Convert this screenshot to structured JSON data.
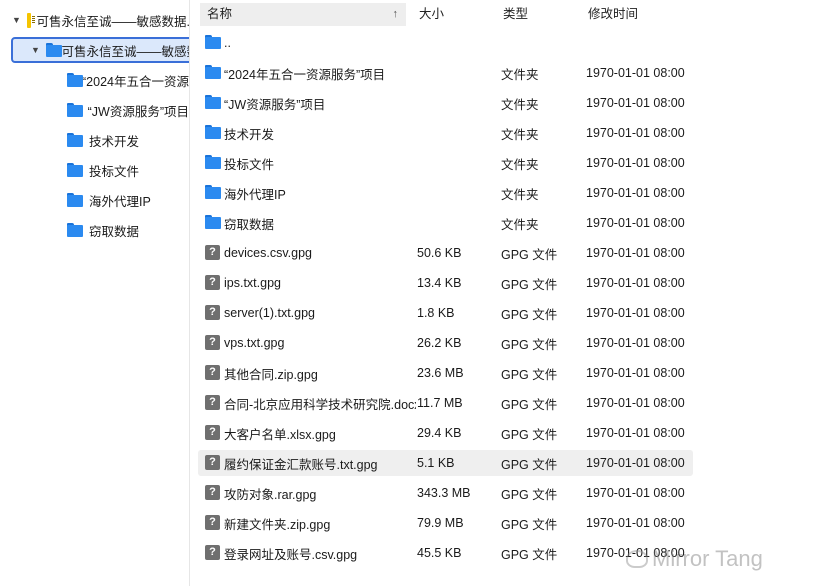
{
  "tree": {
    "root_label": "可售永信至诚——敏感数据.",
    "selected_label": "可售永信至诚——敏感数",
    "children": [
      {
        "label": "“2024年五合一资源"
      },
      {
        "label": "“JW资源服务”项目"
      },
      {
        "label": "技术开发"
      },
      {
        "label": "投标文件"
      },
      {
        "label": "海外代理IP"
      },
      {
        "label": "窃取数据"
      }
    ]
  },
  "columns": {
    "name": "名称",
    "size": "大小",
    "type": "类型",
    "modified": "修改时间",
    "sort_indicator": "↑"
  },
  "files": [
    {
      "icon": "folder-icon",
      "name": "..",
      "size": "",
      "type": "",
      "modified": ""
    },
    {
      "icon": "folder-icon",
      "name": "“2024年五合一资源服务”项目",
      "size": "",
      "type": "文件夹",
      "modified": "1970-01-01 08:00"
    },
    {
      "icon": "folder-icon",
      "name": "“JW资源服务”项目",
      "size": "",
      "type": "文件夹",
      "modified": "1970-01-01 08:00"
    },
    {
      "icon": "folder-icon",
      "name": "技术开发",
      "size": "",
      "type": "文件夹",
      "modified": "1970-01-01 08:00"
    },
    {
      "icon": "folder-icon",
      "name": "投标文件",
      "size": "",
      "type": "文件夹",
      "modified": "1970-01-01 08:00"
    },
    {
      "icon": "folder-icon",
      "name": "海外代理IP",
      "size": "",
      "type": "文件夹",
      "modified": "1970-01-01 08:00"
    },
    {
      "icon": "folder-icon",
      "name": "窃取数据",
      "size": "",
      "type": "文件夹",
      "modified": "1970-01-01 08:00"
    },
    {
      "icon": "unknown-file-icon",
      "name": "devices.csv.gpg",
      "size": "50.6 KB",
      "type": "GPG 文件",
      "modified": "1970-01-01 08:00"
    },
    {
      "icon": "unknown-file-icon",
      "name": "ips.txt.gpg",
      "size": "13.4 KB",
      "type": "GPG 文件",
      "modified": "1970-01-01 08:00"
    },
    {
      "icon": "unknown-file-icon",
      "name": "server(1).txt.gpg",
      "size": "1.8 KB",
      "type": "GPG 文件",
      "modified": "1970-01-01 08:00"
    },
    {
      "icon": "unknown-file-icon",
      "name": "vps.txt.gpg",
      "size": "26.2 KB",
      "type": "GPG 文件",
      "modified": "1970-01-01 08:00"
    },
    {
      "icon": "unknown-file-icon",
      "name": "其他合同.zip.gpg",
      "size": "23.6 MB",
      "type": "GPG 文件",
      "modified": "1970-01-01 08:00"
    },
    {
      "icon": "unknown-file-icon",
      "name": "合同-北京应用科学技术研究院.docx...",
      "size": "11.7 MB",
      "type": "GPG 文件",
      "modified": "1970-01-01 08:00"
    },
    {
      "icon": "unknown-file-icon",
      "name": "大客户名单.xlsx.gpg",
      "size": "29.4 KB",
      "type": "GPG 文件",
      "modified": "1970-01-01 08:00"
    },
    {
      "icon": "unknown-file-icon",
      "name": "履约保证金汇款账号.txt.gpg",
      "size": "5.1 KB",
      "type": "GPG 文件",
      "modified": "1970-01-01 08:00",
      "highlighted": true
    },
    {
      "icon": "unknown-file-icon",
      "name": "攻防对象.rar.gpg",
      "size": "343.3 MB",
      "type": "GPG 文件",
      "modified": "1970-01-01 08:00"
    },
    {
      "icon": "unknown-file-icon",
      "name": "新建文件夹.zip.gpg",
      "size": "79.9 MB",
      "type": "GPG 文件",
      "modified": "1970-01-01 08:00"
    },
    {
      "icon": "unknown-file-icon",
      "name": "登录网址及账号.csv.gpg",
      "size": "45.5 KB",
      "type": "GPG 文件",
      "modified": "1970-01-01 08:00"
    }
  ],
  "watermark": "Mirror Tang"
}
